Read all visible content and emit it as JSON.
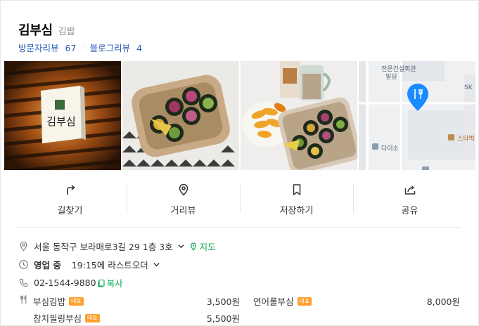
{
  "place": {
    "name": "김부심",
    "category": "김밥",
    "visitor_reviews_label": "방문자리뷰",
    "visitor_reviews_count": "67",
    "blog_reviews_label": "블로그리뷰",
    "blog_reviews_count": "4"
  },
  "photos": [
    {
      "name": "storefront-sign-photo",
      "sign_text": "김부심"
    },
    {
      "name": "kimbap-box-photo"
    },
    {
      "name": "kimbap-mango-drink-photo"
    },
    {
      "name": "location-map-thumbnail",
      "labels": [
        "전문건설회관",
        "빌딩",
        "다이소",
        "SK",
        "스타벅"
      ]
    }
  ],
  "actions": [
    {
      "name": "directions",
      "label": "길찾기",
      "icon": "directions-arrow-icon"
    },
    {
      "name": "street-view",
      "label": "거리뷰",
      "icon": "location-pin-icon"
    },
    {
      "name": "save",
      "label": "저장하기",
      "icon": "bookmark-icon"
    },
    {
      "name": "share",
      "label": "공유",
      "icon": "share-icon"
    }
  ],
  "info": {
    "address": "서울 동작구 보라매로3길 29 1층 3호",
    "map_label": "지도",
    "status": "영업 중",
    "hours": "19:15에 라스트오더",
    "phone": "02-1544-9880",
    "copy_label": "복사"
  },
  "menu": [
    {
      "name": "부심김밥",
      "badge": "대표",
      "price": "3,500원"
    },
    {
      "name": "연어롤부심",
      "badge": "대표",
      "price": "8,000원"
    },
    {
      "name": "참치필링부심",
      "badge": "대표",
      "price": "5,500원"
    }
  ],
  "colors": {
    "link_blue": "#2d5fb8",
    "naver_green": "#03a94d",
    "badge_orange": "#ff9f2e",
    "map_pin_blue": "#1a8cff"
  }
}
